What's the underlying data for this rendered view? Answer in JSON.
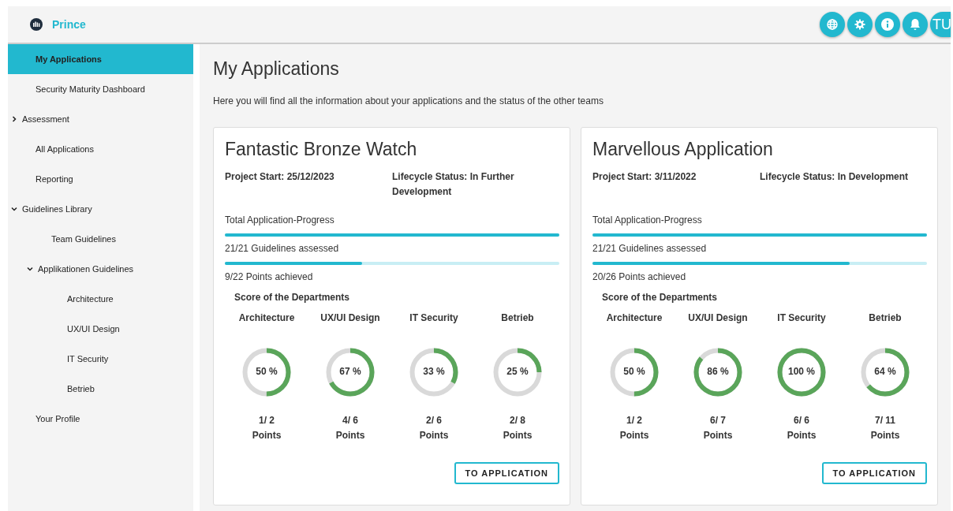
{
  "header": {
    "brand": "Prince",
    "avatar": "TU"
  },
  "sidebar": {
    "items": [
      {
        "label": "My Applications",
        "selected": true
      },
      {
        "label": "Security Maturity Dashboard",
        "selected": false
      },
      {
        "label": "Assessment",
        "selected": false,
        "expanded": false
      },
      {
        "label": "All Applications",
        "selected": false
      },
      {
        "label": "Reporting",
        "selected": false
      },
      {
        "label": "Guidelines Library",
        "selected": false,
        "expanded": true,
        "children": [
          {
            "label": "Team Guidelines",
            "selected": false
          },
          {
            "label": "Applikationen Guidelines",
            "selected": false,
            "expanded": true,
            "children": [
              {
                "label": "Architecture",
                "selected": false
              },
              {
                "label": "UX/UI Design",
                "selected": false
              },
              {
                "label": "IT Security",
                "selected": false
              },
              {
                "label": "Betrieb",
                "selected": false
              }
            ]
          }
        ]
      },
      {
        "label": "Your Profile",
        "selected": false
      }
    ]
  },
  "page": {
    "title": "My Applications",
    "subtitle": "Here you will find all the information about your applications and the status of the other teams"
  },
  "cards": [
    {
      "title": "Fantastic Bronze Watch",
      "project_start": "Project Start: 25/12/2023",
      "lifecycle": "Lifecycle Status: In Further Development",
      "progress_label": "Total Application-Progress",
      "guidelines_bar": {
        "level": 1
      },
      "guidelines_text": "21/21 Guidelines assessed",
      "points_bar": {
        "level": 0.41
      },
      "points_text": "9/22 Points achieved",
      "score_title": "Score of the Departments",
      "button": "TO APPLICATION",
      "departments": [
        {
          "name": "Architecture",
          "level": 0.5,
          "percent": "50 %",
          "points": "1/ 2",
          "unit": "Points"
        },
        {
          "name": "UX/UI Design",
          "level": 0.67,
          "percent": "67 %",
          "points": "4/ 6",
          "unit": "Points"
        },
        {
          "name": "IT Security",
          "level": 0.33,
          "percent": "33 %",
          "points": "2/ 6",
          "unit": "Points"
        },
        {
          "name": "Betrieb",
          "level": 0.25,
          "percent": "25 %",
          "points": "2/ 8",
          "unit": "Points"
        }
      ]
    },
    {
      "title": "Marvellous Application",
      "project_start": "Project Start: 3/11/2022",
      "lifecycle": "Lifecycle Status: In Development",
      "progress_label": "Total Application-Progress",
      "guidelines_bar": {
        "level": 1
      },
      "guidelines_text": "21/21 Guidelines assessed",
      "points_bar": {
        "level": 0.77
      },
      "points_text": "20/26 Points achieved",
      "score_title": "Score of the Departments",
      "button": "TO APPLICATION",
      "departments": [
        {
          "name": "Architecture",
          "level": 0.5,
          "percent": "50 %",
          "points": "1/ 2",
          "unit": "Points"
        },
        {
          "name": "UX/UI Design",
          "level": 0.86,
          "percent": "86 %",
          "points": "6/ 7",
          "unit": "Points"
        },
        {
          "name": "IT Security",
          "level": 1,
          "percent": "100 %",
          "points": "6/ 6",
          "unit": "Points"
        },
        {
          "name": "Betrieb",
          "level": 0.64,
          "percent": "64 %",
          "points": "7/ 11",
          "unit": "Points"
        }
      ]
    }
  ]
}
